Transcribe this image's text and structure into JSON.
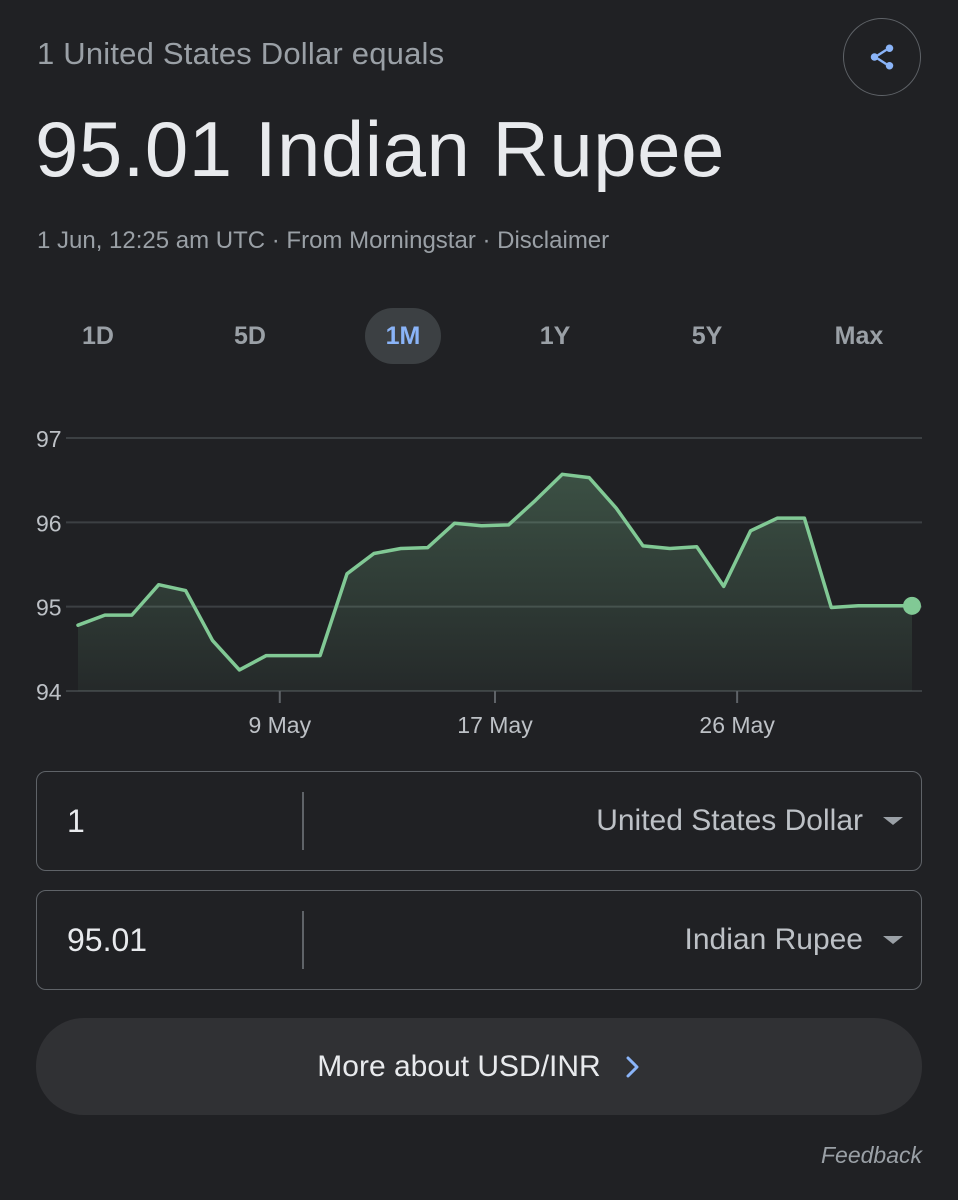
{
  "header": {
    "subtitle": "1 United States Dollar equals",
    "value": "95.01 Indian Rupee",
    "meta": "1 Jun, 12:25 am UTC · From Morningstar · Disclaimer"
  },
  "tabs": [
    {
      "label": "1D",
      "active": false
    },
    {
      "label": "5D",
      "active": false
    },
    {
      "label": "1M",
      "active": true
    },
    {
      "label": "1Y",
      "active": false
    },
    {
      "label": "5Y",
      "active": false
    },
    {
      "label": "Max",
      "active": false
    }
  ],
  "chart_data": {
    "type": "area",
    "title": "",
    "ylim": [
      94,
      97
    ],
    "y_ticks": [
      "97",
      "96",
      "95",
      "94"
    ],
    "x_ticks": [
      "9 May",
      "17 May",
      "26 May"
    ],
    "grid": true,
    "line_color": "#81c995",
    "points": [
      94.78,
      94.9,
      94.9,
      95.26,
      95.19,
      94.6,
      94.25,
      94.42,
      94.42,
      94.42,
      95.39,
      95.63,
      95.69,
      95.7,
      95.99,
      95.96,
      95.97,
      96.26,
      96.57,
      96.53,
      96.17,
      95.72,
      95.69,
      95.71,
      95.24,
      95.9,
      96.05,
      96.05,
      94.99,
      95.01,
      95.01,
      95.01
    ],
    "x_tick_positions": [
      7.5,
      15.5,
      24.5
    ]
  },
  "converter": {
    "from": {
      "amount": "1",
      "currency": "United States Dollar"
    },
    "to": {
      "amount": "95.01",
      "currency": "Indian Rupee"
    }
  },
  "more_button": {
    "label": "More about USD/INR"
  },
  "feedback": "Feedback",
  "colors": {
    "accent": "#8ab4f8",
    "line": "#81c995",
    "background": "#202124"
  }
}
